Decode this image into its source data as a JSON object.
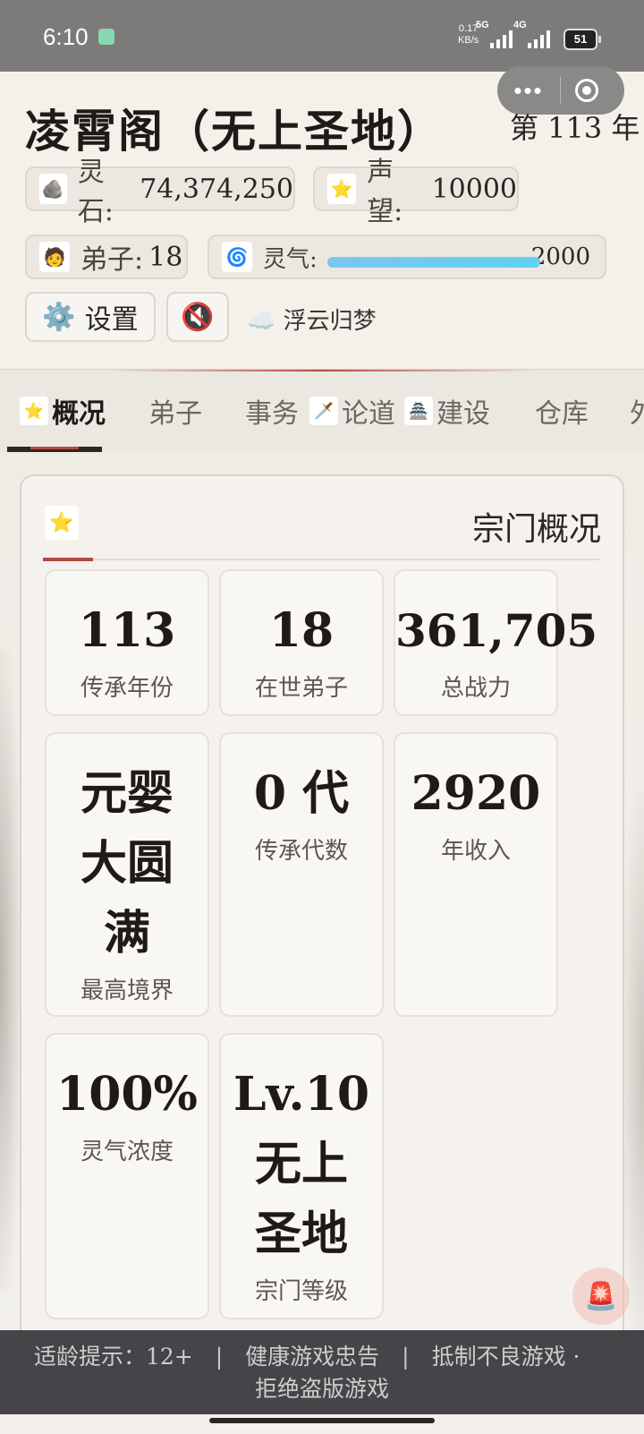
{
  "status_bar": {
    "time": "6:10",
    "net_speed": "0.17",
    "net_unit": "KB/s",
    "sig1": "5G",
    "sig2": "4G",
    "battery": "51"
  },
  "capsule": {
    "more": "•••"
  },
  "header": {
    "title": "凌霄阁（无上圣地）",
    "year": "第 113 年",
    "stats": {
      "spirit_stone_label": "灵石:",
      "spirit_stone_value": "74,374,250",
      "prestige_label": "声望:",
      "prestige_value": "10000",
      "disciples_label": "弟子:",
      "disciples_value": "18",
      "qi_label": "灵气:",
      "qi_value": "2000",
      "qi_fill": 1.0
    },
    "settings_label": "设置",
    "settings_icon": "⚙️",
    "mute_icon": "🔇",
    "weather_icon": "☁️",
    "weather_text": "浮云归梦"
  },
  "tabs": [
    {
      "label": "概况"
    },
    {
      "label": "弟子"
    },
    {
      "label": "事务"
    },
    {
      "label": "论道"
    },
    {
      "label": "建设"
    },
    {
      "label": "仓库"
    },
    {
      "label": "外"
    }
  ],
  "panel": {
    "title": "宗门概况",
    "cards": [
      {
        "value": "113",
        "label": "传承年份"
      },
      {
        "value": "18",
        "label": "在世弟子"
      },
      {
        "value": "361,705",
        "label": "总战力"
      },
      {
        "value": "元婴\n大圆\n满",
        "label": "最高境界"
      },
      {
        "value": "0 代",
        "label": "传承代数"
      },
      {
        "value": "2920",
        "label": "年收入"
      },
      {
        "value": "100%",
        "label": "灵气浓度"
      },
      {
        "value": "Lv.10\n无上\n圣地",
        "label": "宗门等级"
      }
    ]
  },
  "footer": {
    "line1": "适龄提示：12+　|　健康游戏忠告　|　抵制不良游戏 ·",
    "line2": "拒绝盗版游戏"
  },
  "colors": {
    "accent": "#b54a3e",
    "qi_bar": "#6ccdf0",
    "footer_bg": "#37373c"
  }
}
